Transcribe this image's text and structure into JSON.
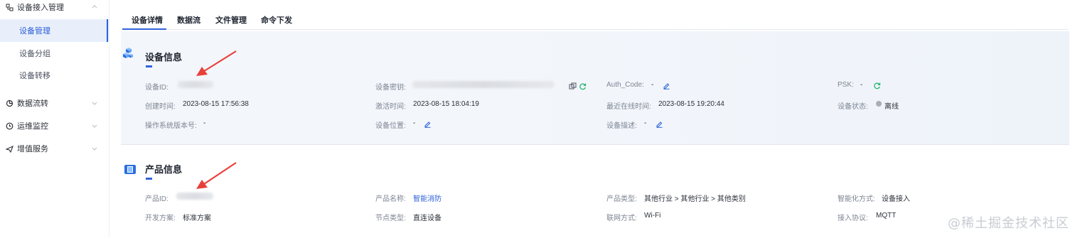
{
  "sidebar": {
    "group1": {
      "label": "设备接入管理",
      "icon": "device-access-icon"
    },
    "sub_items": [
      {
        "label": "设备管理",
        "active": true
      },
      {
        "label": "设备分组",
        "active": false
      },
      {
        "label": "设备转移",
        "active": false
      }
    ],
    "group2": {
      "label": "数据流转",
      "icon": "data-flow-icon"
    },
    "group3": {
      "label": "运维监控",
      "icon": "ops-monitor-icon"
    },
    "group4": {
      "label": "增值服务",
      "icon": "value-added-icon"
    }
  },
  "tabs": [
    {
      "label": "设备详情",
      "active": true
    },
    {
      "label": "数据流",
      "active": false
    },
    {
      "label": "文件管理",
      "active": false
    },
    {
      "label": "命令下发",
      "active": false
    }
  ],
  "device_info": {
    "title": "设备信息",
    "device_id_label": "设备ID:",
    "device_key_label": "设备密钥:",
    "auth_code_label": "Auth_Code:",
    "auth_code_value": "-",
    "psk_label": "PSK:",
    "psk_value": "-",
    "created_label": "创建时间:",
    "created_value": "2023-08-15 17:56:38",
    "activated_label": "激活时间:",
    "activated_value": "2023-08-15 18:04:19",
    "last_online_label": "最近在线时间:",
    "last_online_value": "2023-08-15 19:20:44",
    "status_label": "设备状态:",
    "status_value": "离线",
    "os_label": "操作系统版本号:",
    "os_value": "-",
    "location_label": "设备位置:",
    "location_value": "-",
    "desc_label": "设备描述:",
    "desc_value": "-"
  },
  "product_info": {
    "title": "产品信息",
    "product_id_label": "产品ID:",
    "product_name_label": "产品名称:",
    "product_name_value": "智能消防",
    "product_type_label": "产品类型:",
    "product_type_value": "其他行业 > 其他行业 > 其他类别",
    "smart_method_label": "智能化方式:",
    "smart_method_value": "设备接入",
    "dev_scheme_label": "开发方案:",
    "dev_scheme_value": "标准方案",
    "node_type_label": "节点类型:",
    "node_type_value": "直连设备",
    "network_label": "联网方式:",
    "network_value": "Wi-Fi",
    "protocol_label": "接入协议:",
    "protocol_value": "MQTT"
  },
  "watermark": "@稀土掘金技术社区",
  "colors": {
    "accent": "#2f64d9",
    "annotation": "#e8413a",
    "sync": "#2bb673"
  }
}
